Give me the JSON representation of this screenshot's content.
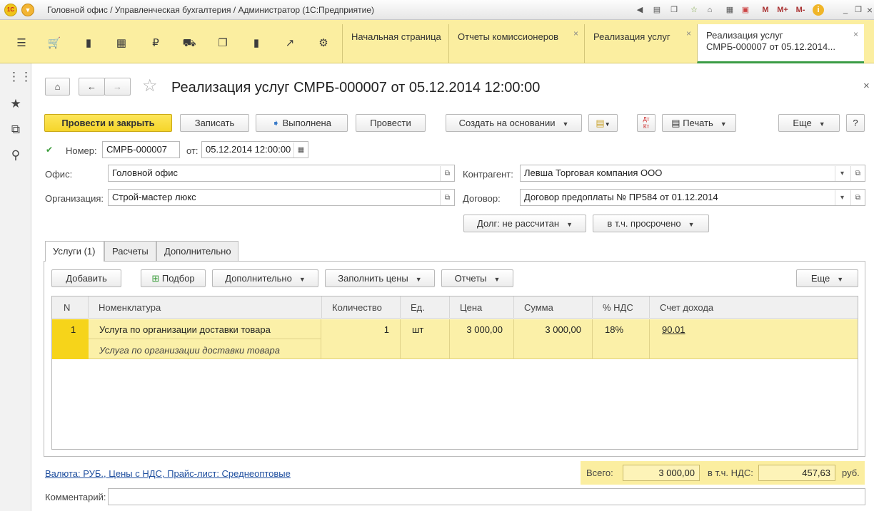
{
  "window": {
    "title": "Головной офис / Управленческая бухгалтерия / Администратор  (1С:Предприятие)",
    "toolbar_icons": [
      "1c-logo-icon",
      "menu-dropdown-icon",
      "back-icon",
      "print-icon",
      "copy-icon",
      "favorite-icon",
      "home-icon",
      "calculator-icon",
      "calendar-icon",
      "memory-m-icon",
      "memory-mplus-icon",
      "memory-mminus-icon",
      "info-icon",
      "minimize-icon",
      "restore-icon",
      "close-icon"
    ],
    "m_label": "M",
    "mplus_label": "M+",
    "mminus_label": "M-"
  },
  "sections": [
    "menu-icon",
    "cart-icon",
    "bag-icon",
    "warehouse-icon",
    "ruble-icon",
    "truck-icon",
    "documents-icon",
    "bar-chart-icon",
    "trend-icon",
    "settings-icon"
  ],
  "open_tabs": [
    {
      "label": "Начальная страница",
      "closable": false,
      "active": false
    },
    {
      "label": "Отчеты комиссионеров",
      "closable": true,
      "active": false
    },
    {
      "label": "Реализация услуг",
      "closable": true,
      "active": false
    },
    {
      "label": "Реализация услуг\nСМРБ-000007 от 05.12.2014...",
      "line1": "Реализация услуг",
      "line2": "СМРБ-000007 от 05.12.2014...",
      "closable": true,
      "active": true
    }
  ],
  "left_panel": [
    "apps-grid-icon",
    "star-icon",
    "history-icon",
    "search-icon"
  ],
  "form": {
    "title": "Реализация услуг СМРБ-000007 от 05.12.2014 12:00:00",
    "buttons": {
      "post_close": "Провести и закрыть",
      "save": "Записать",
      "done": "Выполнена",
      "post": "Провести",
      "create_based": "Создать на основании",
      "print": "Печать",
      "more": "Еще",
      "help": "?"
    },
    "number_label": "Номер:",
    "number_value": "СМРБ-000007",
    "date_label": "от:",
    "date_value": "05.12.2014 12:00:00",
    "office_label": "Офис:",
    "office_value": "Головной офис",
    "org_label": "Организация:",
    "org_value": "Строй-мастер люкс",
    "counterparty_label": "Контрагент:",
    "counterparty_value": "Левша Торговая компания ООО",
    "contract_label": "Договор:",
    "contract_value": "Договор предоплаты № ПР584 от 01.12.2014",
    "debt_button": "Долг: не рассчитан",
    "overdue_button": "в т.ч. просрочено"
  },
  "tabs": [
    {
      "label": "Услуги (1)",
      "active": true
    },
    {
      "label": "Расчеты",
      "active": false
    },
    {
      "label": "Дополнительно",
      "active": false
    }
  ],
  "table_toolbar": {
    "add": "Добавить",
    "pick": "Подбор",
    "extra": "Дополнительно",
    "fill_prices": "Заполнить цены",
    "reports": "Отчеты",
    "more": "Еще"
  },
  "table": {
    "columns": [
      "N",
      "Номенклатура",
      "Количество",
      "Ед.",
      "Цена",
      "Сумма",
      "% НДС",
      "Счет дохода"
    ],
    "rows": [
      {
        "n": "1",
        "item": "Услуга по организации доставки товара",
        "item_desc": "Услуга по организации доставки товара",
        "qty": "1",
        "unit": "шт",
        "price": "3 000,00",
        "sum": "3 000,00",
        "vat": "18%",
        "account": "90.01"
      }
    ]
  },
  "footer": {
    "currency_link": "Валюта: РУБ., Цены с НДС, Прайс-лист: Среднеоптовые",
    "total_label": "Всего:",
    "total_value": "3 000,00",
    "vat_label": "в т.ч. НДС:",
    "vat_value": "457,63",
    "currency": "руб.",
    "comment_label": "Комментарий:",
    "comment_value": ""
  },
  "colors": {
    "accent_yellow": "#fbeea0",
    "primary_button": "#f5d52a",
    "active_tab_underline": "#3b9c45",
    "selected_row": "#fbf0a8",
    "link": "#1f4f9f"
  }
}
